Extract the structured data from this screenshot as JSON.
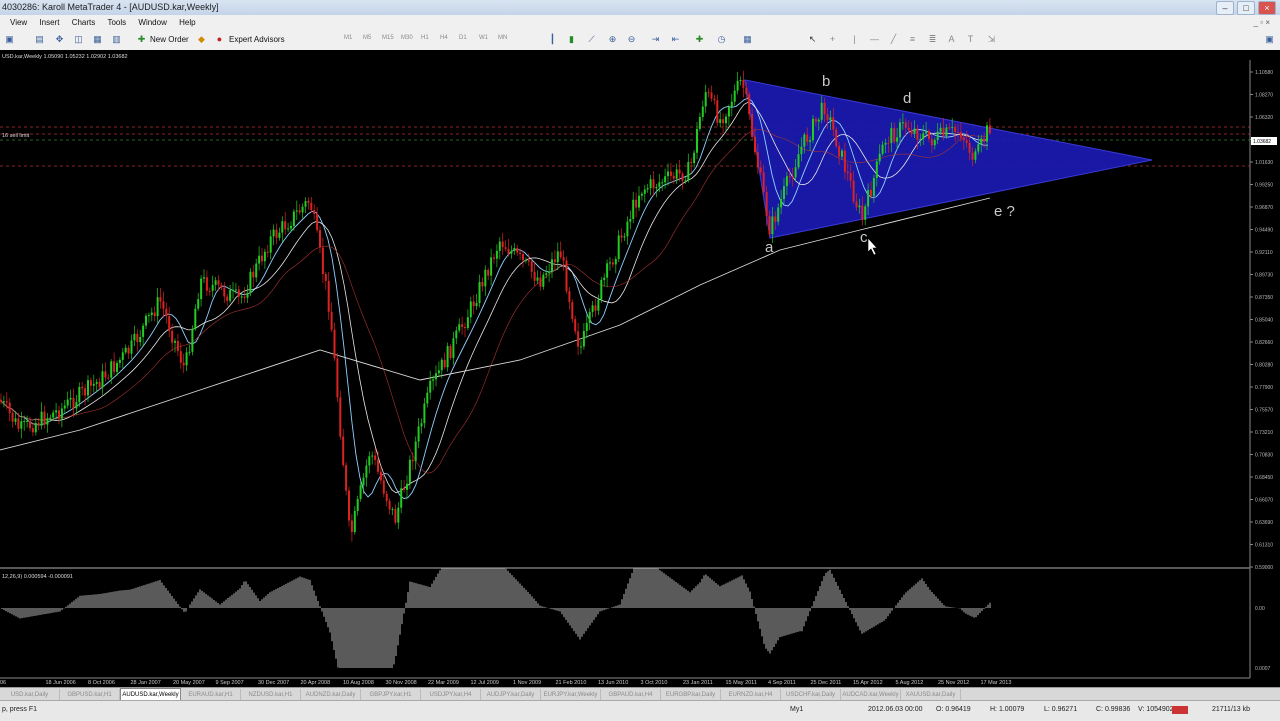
{
  "window": {
    "title": "4030286: Karoll MetaTrader 4 - [AUDUSD.kar,Weekly]"
  },
  "menu": [
    "View",
    "Insert",
    "Charts",
    "Tools",
    "Window",
    "Help"
  ],
  "toolbar": {
    "new_order": "New Order",
    "expert_advisors": "Expert Advisors",
    "timeframes": [
      "M1",
      "M5",
      "M15",
      "M30",
      "H1",
      "H4",
      "D1",
      "W1",
      "MN"
    ]
  },
  "chart": {
    "info_line": "USD.kar,Weekly  1.05090 1.05232 1.02902 1.03682",
    "left_note": "16 sell limit",
    "indicator_info": "12,26,9) 0.000594 -0.000091",
    "price_labels": [
      "1.10580",
      "1.08270",
      "1.06320",
      "1.03682",
      "1.01630",
      "0.99250",
      "0.96870",
      "0.94490",
      "0.92110",
      "0.89730",
      "0.87350",
      "0.85040",
      "0.82660",
      "0.80280",
      "0.77900",
      "0.75570",
      "0.73210",
      "0.70830",
      "0.68450",
      "0.66070",
      "0.63690",
      "0.61310",
      "0.59000"
    ],
    "current_price": "1.03682",
    "macd_labels": [
      "0.00",
      "0.0007"
    ],
    "date_labels": [
      "06",
      "18 Jun 2006",
      "8 Oct 2006",
      "28 Jan 2007",
      "20 May 2007",
      "9 Sep 2007",
      "30 Dec 2007",
      "20 Apr 2008",
      "10 Aug 2008",
      "30 Nov 2008",
      "22 Mar 2009",
      "12 Jul 2009",
      "1 Nov 2009",
      "21 Feb 2010",
      "13 Jun 2010",
      "3 Oct 2010",
      "23 Jan 2011",
      "15 May 2011",
      "4 Sep 2011",
      "25 Dec 2011",
      "15 Apr 2012",
      "5 Aug 2012",
      "25 Nov 2012",
      "17 Mar 2013"
    ],
    "wave_labels": [
      "a",
      "b",
      "c",
      "d",
      "e ?"
    ],
    "colors": {
      "bull": "#22cc22",
      "bear": "#dd2222",
      "triangle": "#1a1ab0",
      "macd": "#c8c8c8"
    }
  },
  "tabs": [
    "USD.kar,Daily",
    "GBPUSD.kar,H1",
    "AUDUSD.kar,Weekly",
    "EURAUD.kar,H1",
    "NZDUSD.kar,H1",
    "AUDNZD.kar,Daily",
    "GBPJPY.kar,H1",
    "USDJPY.kar,H4",
    "AUDJPY.kar,Daily",
    "EURJPY.kar,Weekly",
    "GBPAUD.kar,H4",
    "EURGBP.kar,Daily",
    "EURNZD.kar,H4",
    "USDCHF.kar,Daily",
    "AUDCAD.kar,Weekly",
    "XAUUSD.kar,Daily"
  ],
  "active_tab": "AUDUSD.kar,Weekly",
  "status": {
    "help": "p, press F1",
    "profile": "My1",
    "datetime": "2012.06.03 00:00",
    "open": "O: 0.96419",
    "high": "H: 1.00079",
    "low": "L: 0.96271",
    "close": "C: 0.99836",
    "volume": "V: 1054902",
    "traffic": "21711/13 kb"
  }
}
